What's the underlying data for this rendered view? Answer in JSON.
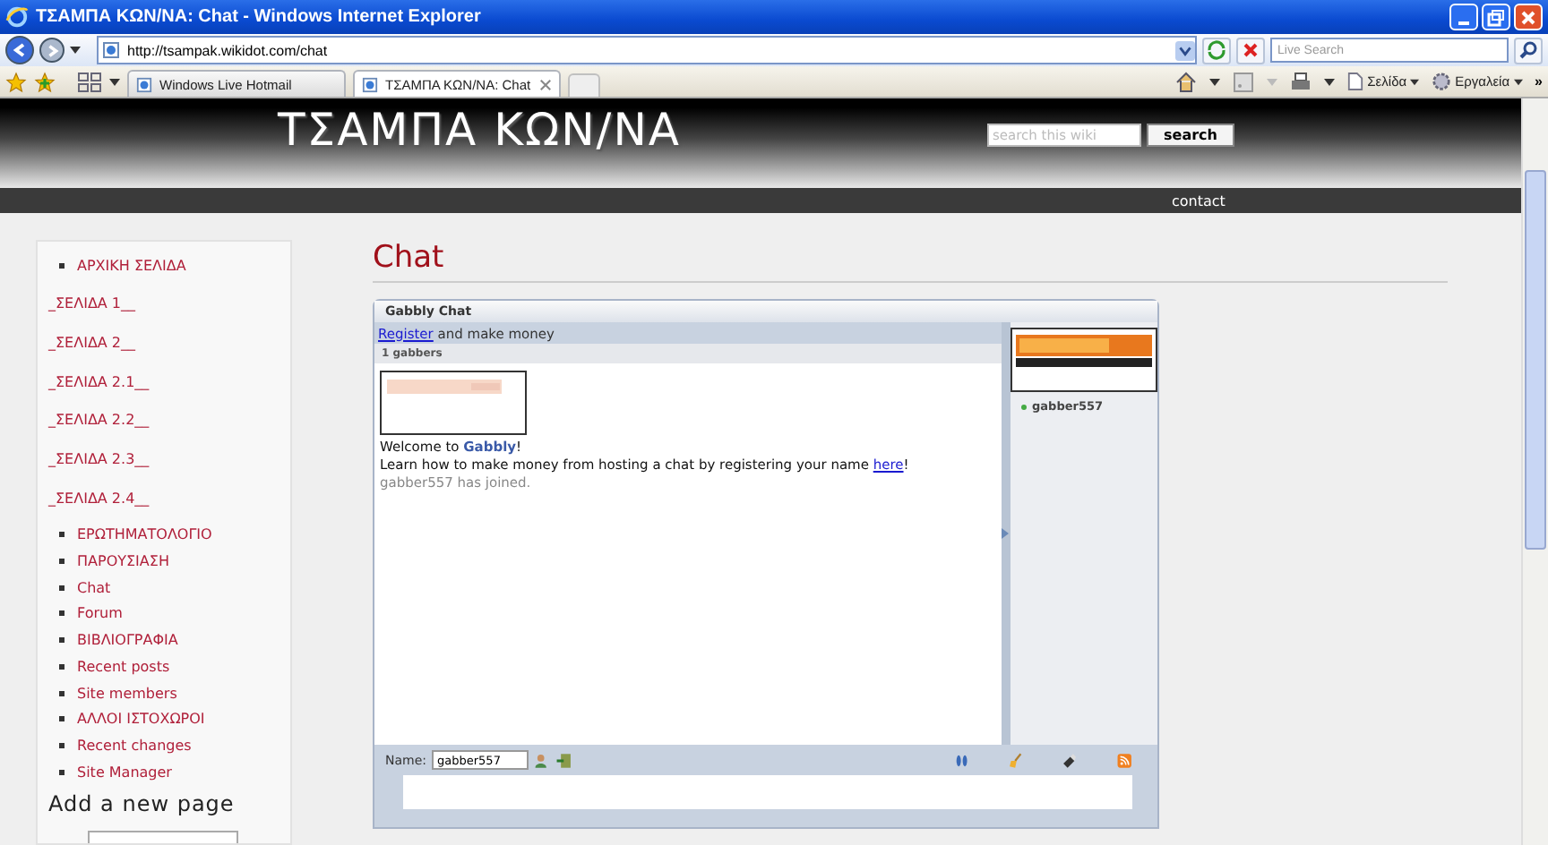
{
  "window": {
    "title": "ΤΣΑΜΠΑ ΚΩΝ/ΝΑ: Chat - Windows Internet Explorer"
  },
  "address_bar": {
    "url": "http://tsampak.wikidot.com/chat",
    "search_placeholder": "Live Search"
  },
  "tabs": [
    {
      "label": "Windows Live Hotmail",
      "selected": false
    },
    {
      "label": "ΤΣΑΜΠΑ ΚΩΝ/ΝΑ: Chat",
      "selected": true
    }
  ],
  "command_bar": {
    "page_menu": "Σελίδα",
    "tools_menu": "Εργαλεία",
    "more": "»"
  },
  "site": {
    "title": "ΤΣΑΜΠΑ ΚΩΝ/ΝΑ",
    "search_placeholder": "search this wiki",
    "search_button": "search",
    "nav": [
      "contact"
    ]
  },
  "sidebar": {
    "items": [
      {
        "kind": "bullet",
        "label": "ΑΡΧΙΚΗ ΣΕΛΙΔΑ"
      },
      {
        "kind": "page",
        "label": "_ΣΕΛΙΔΑ 1__"
      },
      {
        "kind": "page",
        "label": "_ΣΕΛΙΔΑ 2__"
      },
      {
        "kind": "page",
        "label": "_ΣΕΛΙΔΑ 2.1__"
      },
      {
        "kind": "page",
        "label": "_ΣΕΛΙΔΑ 2.2__"
      },
      {
        "kind": "page",
        "label": "_ΣΕΛΙΔΑ 2.3__"
      },
      {
        "kind": "page",
        "label": "_ΣΕΛΙΔΑ 2.4__"
      },
      {
        "kind": "bullet",
        "label": "ΕΡΩΤΗΜΑΤΟΛΟΓΙΟ"
      },
      {
        "kind": "bullet",
        "label": "ΠΑΡΟΥΣΙΑΣΗ"
      },
      {
        "kind": "bullet",
        "label": "Chat"
      },
      {
        "kind": "bullet",
        "label": "Forum"
      },
      {
        "kind": "bullet",
        "label": "ΒΙΒΛΙΟΓΡΑΦΙΑ"
      },
      {
        "kind": "bullet",
        "label": "Recent posts"
      },
      {
        "kind": "bullet",
        "label": "Site members"
      },
      {
        "kind": "bullet",
        "label": "ΑΛΛΟΙ ΙΣΤΟΧΩΡΟΙ"
      },
      {
        "kind": "bullet",
        "label": "Recent changes"
      },
      {
        "kind": "bullet",
        "label": "Site Manager"
      }
    ],
    "add_page_title": "Add a new page"
  },
  "page_title": "Chat",
  "chat": {
    "title": "Gabbly Chat",
    "register_link": "Register",
    "register_text": "and make money",
    "count": "1 gabbers",
    "messages": [
      {
        "kind": "welcome",
        "text": "Welcome to **Gabbly**!"
      },
      {
        "kind": "link",
        "before": "Learn how to make money from hosting a chat by registering your name",
        "link": "here",
        "after": "!"
      },
      {
        "kind": "system",
        "text": "gabber557 has joined."
      }
    ],
    "users": [
      {
        "name": "gabber557"
      }
    ],
    "name_label": "Name:",
    "name_value": "gabber557"
  }
}
